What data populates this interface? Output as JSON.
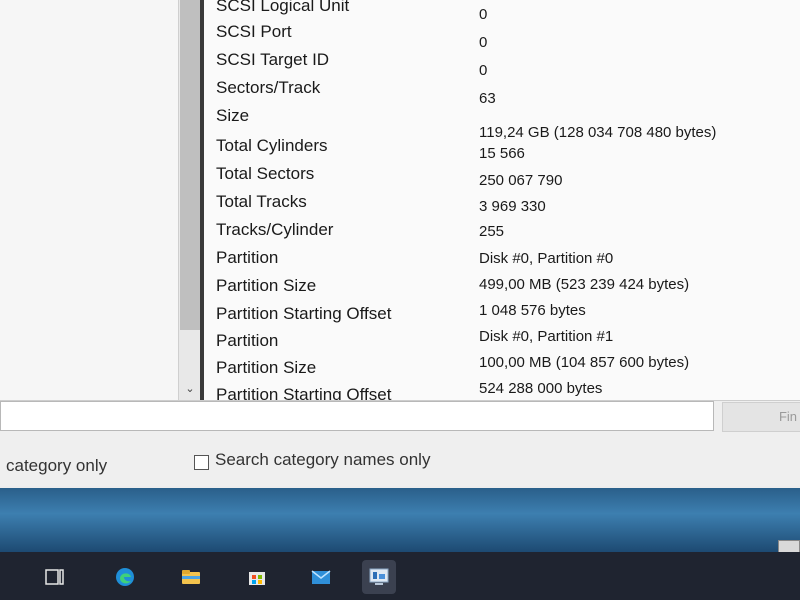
{
  "details": {
    "rows": [
      {
        "property": "SCSI Logical Unit",
        "value": "0"
      },
      {
        "property": "SCSI Port",
        "value": "0"
      },
      {
        "property": "SCSI Target ID",
        "value": "0"
      },
      {
        "property": "Sectors/Track",
        "value": "63"
      },
      {
        "property": "Size",
        "value": "119,24 GB (128 034 708 480 bytes)"
      },
      {
        "property": "Total Cylinders",
        "value": "15 566"
      },
      {
        "property": "Total Sectors",
        "value": "250 067 790"
      },
      {
        "property": "Total Tracks",
        "value": "3 969 330"
      },
      {
        "property": "Tracks/Cylinder",
        "value": "255"
      },
      {
        "property": "Partition",
        "value": "Disk #0, Partition #0"
      },
      {
        "property": "Partition Size",
        "value": "499,00 MB (523 239 424 bytes)"
      },
      {
        "property": "Partition Starting Offset",
        "value": "1 048 576 bytes"
      },
      {
        "property": "Partition",
        "value": "Disk #0, Partition #1"
      },
      {
        "property": "Partition Size",
        "value": "100,00 MB (104 857 600 bytes)"
      },
      {
        "property": "Partition Starting Offset",
        "value": "524 288 000 bytes"
      }
    ]
  },
  "search": {
    "input_value": "",
    "find_label": "Fin"
  },
  "options": {
    "category_only_label": "category only",
    "search_category_names_label": "Search category names only",
    "search_category_names_checked": false
  },
  "taskbar": {
    "items": [
      {
        "icon": "task-view-icon",
        "active": false
      },
      {
        "icon": "edge-icon",
        "active": false
      },
      {
        "icon": "file-explorer-icon",
        "active": false
      },
      {
        "icon": "microsoft-store-icon",
        "active": false
      },
      {
        "icon": "mail-icon",
        "active": false
      },
      {
        "icon": "system-information-icon",
        "active": true
      }
    ]
  },
  "colors": {
    "taskbar": "#1f2430",
    "window_bg": "#ededed",
    "text": "#1a1a1a"
  }
}
